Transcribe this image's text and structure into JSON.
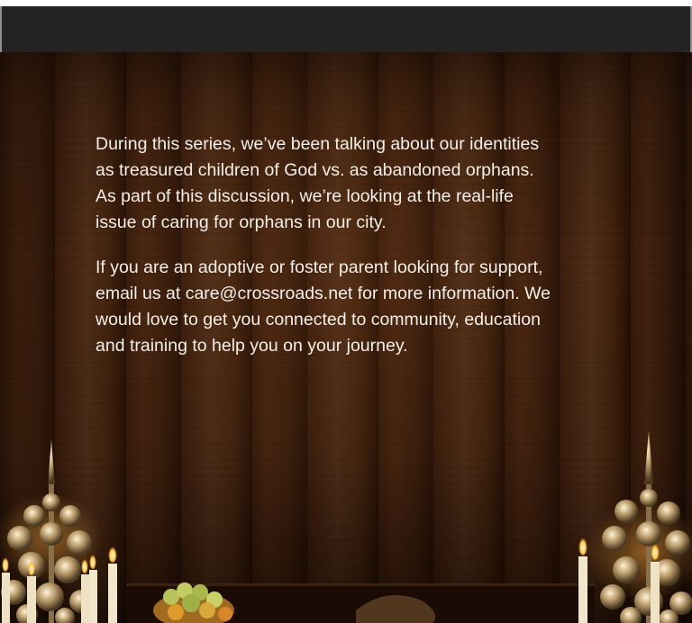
{
  "hero": {
    "paragraphs": [
      "During this series, we’ve been talking about our identities as treasured children of God vs. as abandoned orphans. As part of this discussion, we’re looking at the real-life issue of caring for orphans in our city.",
      "If you are an adoptive or foster parent looking for support, email us at care@crossroads.net for more information. We would love to get you connected to community, education and training to help you on your journey."
    ]
  },
  "colors": {
    "top_bar": "#232323",
    "text": "#f4efe8",
    "wood_dark": "#2c1508",
    "wood_light": "#52301a"
  },
  "icons": [
    "candelabra-left",
    "candelabra-right",
    "candles",
    "fruit-bowl"
  ]
}
